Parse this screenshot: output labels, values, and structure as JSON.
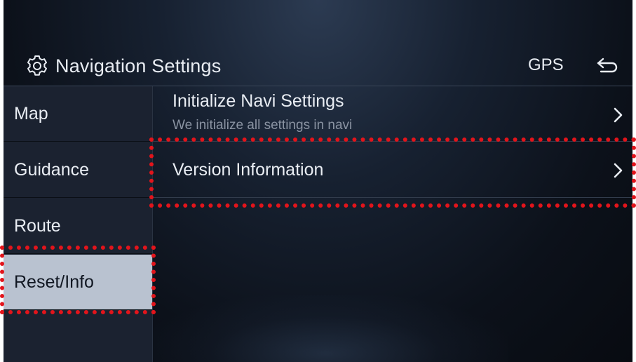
{
  "header": {
    "title": "Navigation Settings",
    "gps_label": "GPS",
    "title_icon": "gear-icon",
    "back_icon": "back-arrow-icon"
  },
  "sidebar": {
    "items": [
      {
        "label": "Map",
        "active": false
      },
      {
        "label": "Guidance",
        "active": false
      },
      {
        "label": "Route",
        "active": false
      },
      {
        "label": "Reset/Info",
        "active": true
      }
    ]
  },
  "main": {
    "items": [
      {
        "title": "Initialize Navi Settings",
        "subtitle": "We initialize all settings in navi",
        "icon": "chevron-right-icon"
      },
      {
        "title": "Version Information",
        "icon": "chevron-right-icon"
      }
    ]
  },
  "colors": {
    "highlight": "#e3141b",
    "active_tab": "#b9c2d0",
    "text": "#e9edf3",
    "subtext": "#8a93a2"
  }
}
